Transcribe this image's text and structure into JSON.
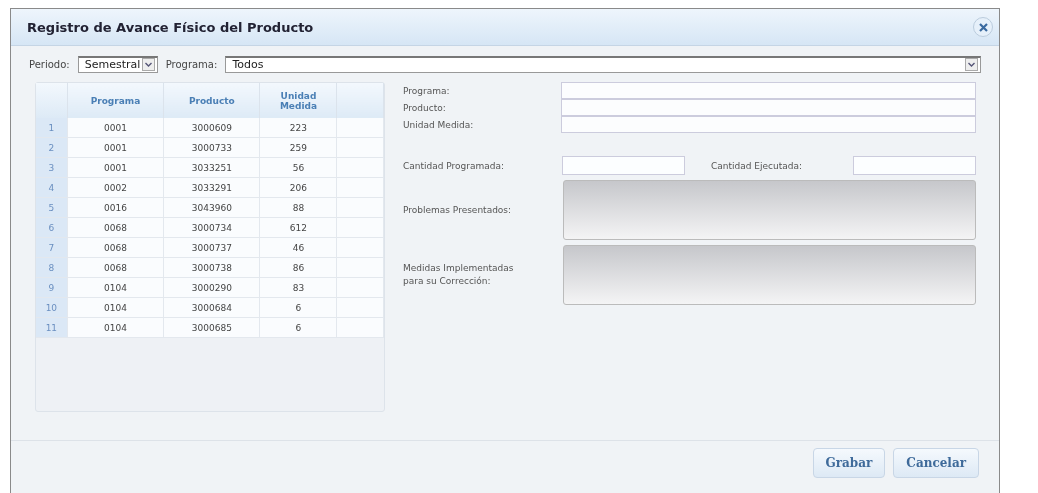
{
  "window": {
    "title": "Registro de Avance Físico del Producto"
  },
  "filters": {
    "periodo_label": "Periodo:",
    "periodo_value": "Semestral",
    "programa_label": "Programa:",
    "programa_value": "Todos"
  },
  "table": {
    "columns": [
      "Programa",
      "Producto",
      "Unidad Medida"
    ],
    "rows": [
      {
        "n": "1",
        "cells": [
          "0001",
          "3000609",
          "223"
        ]
      },
      {
        "n": "2",
        "cells": [
          "0001",
          "3000733",
          "259"
        ]
      },
      {
        "n": "3",
        "cells": [
          "0001",
          "3033251",
          "56"
        ]
      },
      {
        "n": "4",
        "cells": [
          "0002",
          "3033291",
          "206"
        ]
      },
      {
        "n": "5",
        "cells": [
          "0016",
          "3043960",
          "88"
        ]
      },
      {
        "n": "6",
        "cells": [
          "0068",
          "3000734",
          "612"
        ]
      },
      {
        "n": "7",
        "cells": [
          "0068",
          "3000737",
          "46"
        ]
      },
      {
        "n": "8",
        "cells": [
          "0068",
          "3000738",
          "86"
        ]
      },
      {
        "n": "9",
        "cells": [
          "0104",
          "3000290",
          "83"
        ]
      },
      {
        "n": "10",
        "cells": [
          "0104",
          "3000684",
          "6"
        ]
      },
      {
        "n": "11",
        "cells": [
          "0104",
          "3000685",
          "6"
        ]
      }
    ]
  },
  "form": {
    "info_fields": [
      "Programa:",
      "Producto:",
      "Unidad Medida:"
    ],
    "cantidad_programada": "Cantidad Programada:",
    "cantidad_ejecutada": "Cantidad Ejecutada:",
    "text_areas": [
      "Problemas Presentados:",
      "Medidas Implementadas para su Corrección:"
    ]
  },
  "buttons": [
    "Grabar",
    "Cancelar"
  ]
}
